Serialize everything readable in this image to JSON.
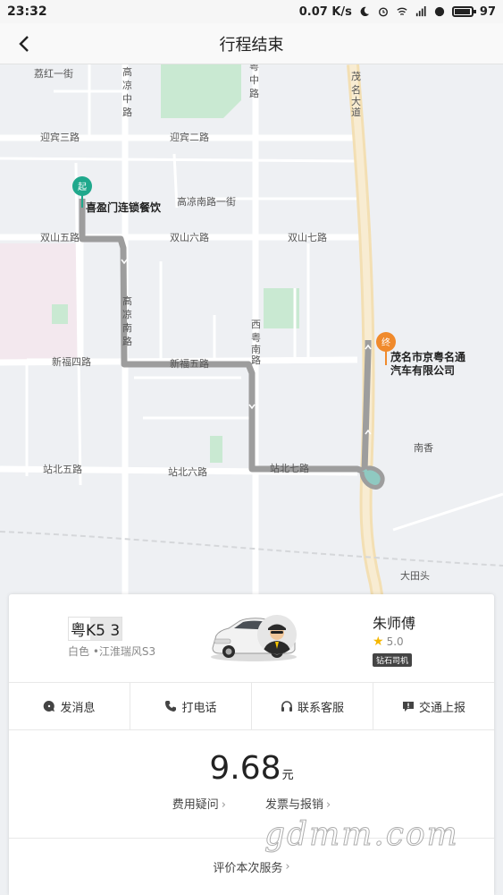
{
  "status_bar": {
    "time": "23:32",
    "net_speed": "0.07 K/s",
    "battery": "97"
  },
  "nav": {
    "title": "行程结束",
    "back_icon": "chevron-left-icon"
  },
  "map": {
    "roads": {
      "lihong1": "荔红一街",
      "gaoliang_mid": "高凉中路",
      "yuebei_mid": "粤中路",
      "maoming_ave": "茂名大道",
      "yingbin3": "迎宾三路",
      "yingbin2": "迎宾二路",
      "gaoliang_south1": "高凉南路一街",
      "shuangshan5": "双山五路",
      "shuangshan6": "双山六路",
      "shuangshan7": "双山七路",
      "gaoliang_south": "高凉南路",
      "xiyue_south": "西粤南路",
      "xinfu4": "新福四路",
      "xinfu5": "新福五路",
      "zhanbei5": "站北五路",
      "zhanbei6": "站北六路",
      "zhanbei7": "站北七路",
      "nanxiang": "南香",
      "datiantou": "大田头"
    },
    "start_marker": "起",
    "start_name": "喜盈门连锁餐饮",
    "end_marker": "终",
    "end_name_line1": "茂名市京粤名通",
    "end_name_line2": "汽车有限公司"
  },
  "driver": {
    "plate": "粤K5    3",
    "car_desc": "白色 •江淮瑞风S3",
    "name": "朱师傅",
    "rating": "5.0",
    "badge": "钻石司机"
  },
  "actions": [
    {
      "label": "发消息",
      "icon": "message-icon"
    },
    {
      "label": "打电话",
      "icon": "phone-icon"
    },
    {
      "label": "联系客服",
      "icon": "headset-icon"
    },
    {
      "label": "交通上报",
      "icon": "report-icon"
    }
  ],
  "fee": {
    "amount": "9.68",
    "unit": "元",
    "question_link": "费用疑问",
    "invoice_link": "发票与报销"
  },
  "rate_link": "评价本次服务",
  "watermark": "gdmm.com",
  "colors": {
    "route": "#9d9d9d",
    "start_marker": "#1fa88c",
    "end_marker": "#f08a2c",
    "map_bg": "#eef0f3",
    "road": "#ffffff",
    "main_road": "#f6e4bf",
    "park": "#c9e9d2"
  }
}
